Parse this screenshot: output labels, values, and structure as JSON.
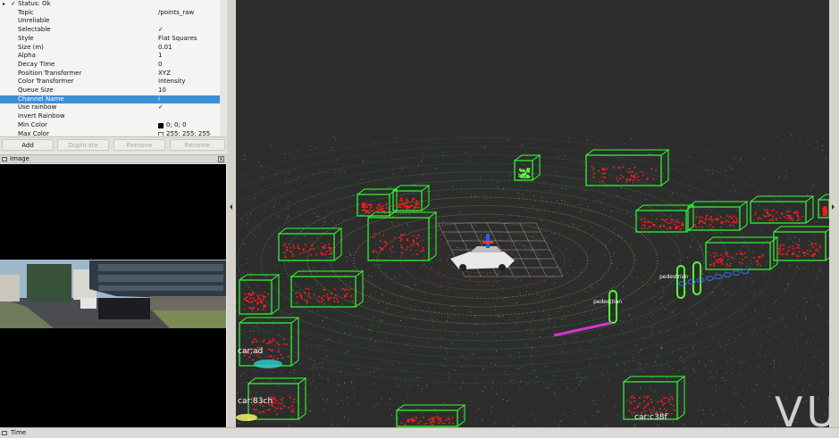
{
  "properties": {
    "status": {
      "label": "Status: Ok",
      "check": "✓"
    },
    "rows": [
      {
        "key": "Topic",
        "value": "/points_raw"
      },
      {
        "key": "Unreliable",
        "value": ""
      },
      {
        "key": "Selectable",
        "value": "✓"
      },
      {
        "key": "Style",
        "value": "Flat Squares"
      },
      {
        "key": "Size (m)",
        "value": "0.01"
      },
      {
        "key": "Alpha",
        "value": "1"
      },
      {
        "key": "Decay Time",
        "value": "0"
      },
      {
        "key": "Position Transformer",
        "value": "XYZ"
      },
      {
        "key": "Color Transformer",
        "value": "Intensity"
      },
      {
        "key": "Queue Size",
        "value": "10"
      },
      {
        "key": "Channel Name",
        "value": "i"
      },
      {
        "key": "Use rainbow",
        "value": "✓"
      },
      {
        "key": "Invert Rainbow",
        "value": ""
      },
      {
        "key": "Min Color",
        "value": "0; 0; 0"
      },
      {
        "key": "Max Color",
        "value": "255; 255; 255"
      }
    ],
    "selected_index": 10
  },
  "buttons": {
    "add": "Add",
    "duplicate": "Duplicate",
    "remove": "Remove",
    "rename": "Rename"
  },
  "image_panel": {
    "title": "Image"
  },
  "time_panel": {
    "title": "Time"
  },
  "scene": {
    "labels": [
      "car:83ch",
      "car:c38f",
      "car:ad",
      "pedestrian",
      "pedestrian"
    ],
    "watermark": "VU"
  },
  "colors": {
    "box": "#33ff33",
    "points_red": "#ff1a1a",
    "label_magenta": "#d633d6",
    "selection": "#3d8ed6",
    "background3d": "#2d2d2d"
  }
}
